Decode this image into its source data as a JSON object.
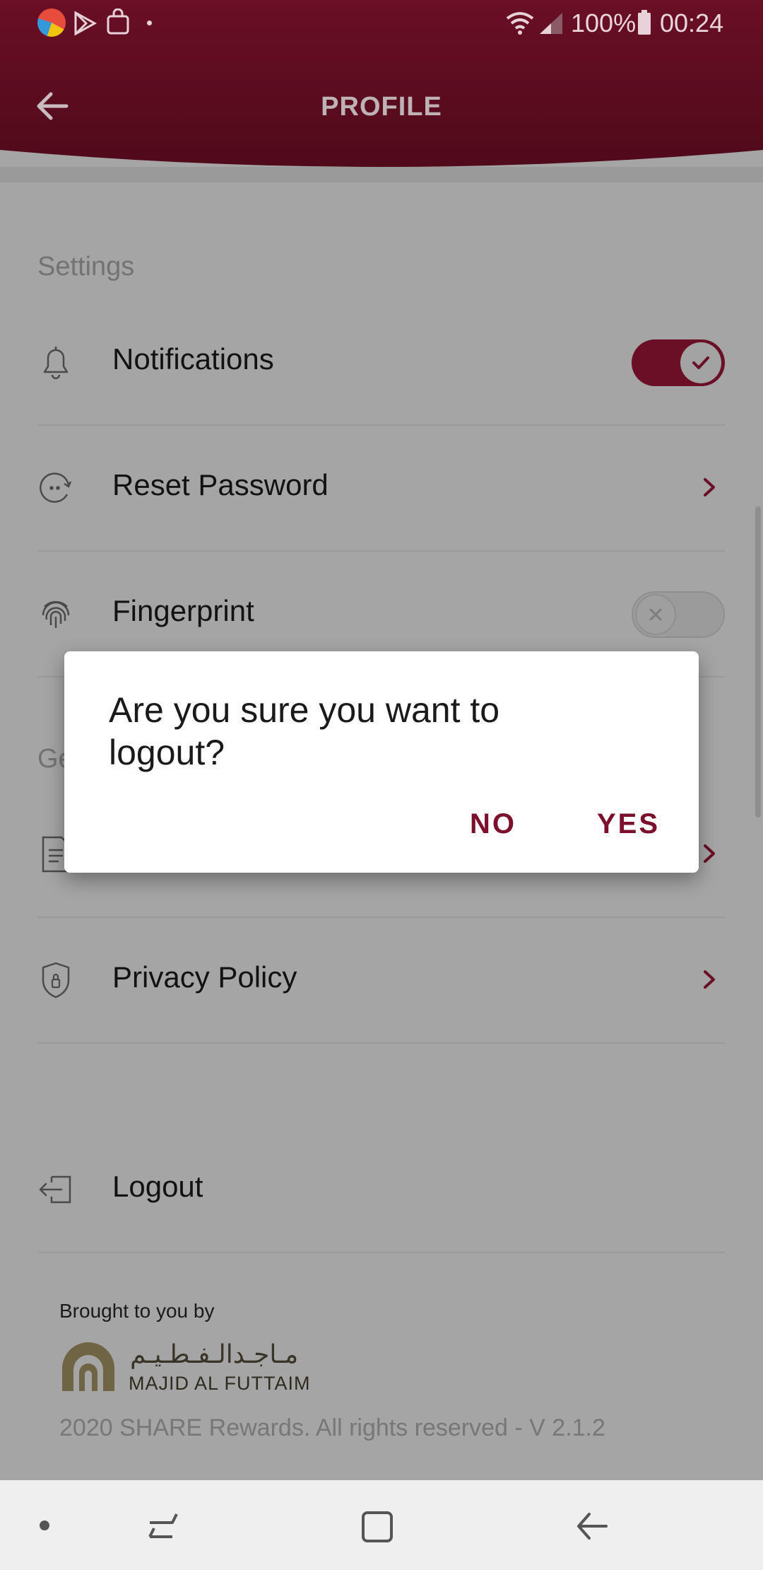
{
  "status_bar": {
    "battery": "100%",
    "time": "00:24",
    "left_icons": [
      "browser-icon",
      "play-store-icon",
      "shopping-bag-icon",
      "dot-icon"
    ],
    "right_icons": [
      "wifi-icon",
      "signal-icon",
      "battery-icon"
    ]
  },
  "header": {
    "title": "PROFILE"
  },
  "settings": {
    "section_title": "Settings",
    "items": [
      {
        "label": "Notifications",
        "icon": "bell-icon",
        "control": "toggle",
        "state": "on"
      },
      {
        "label": "Reset Password",
        "icon": "password-reset-icon",
        "control": "chevron"
      },
      {
        "label": "Fingerprint",
        "icon": "fingerprint-icon",
        "control": "toggle",
        "state": "off"
      }
    ]
  },
  "general": {
    "section_title_partial": "Ge",
    "items": [
      {
        "label": "",
        "icon": "document-icon",
        "control": "chevron"
      },
      {
        "label": "Privacy Policy",
        "icon": "shield-icon",
        "control": "chevron"
      }
    ]
  },
  "logout": {
    "label": "Logout",
    "icon": "logout-icon"
  },
  "footer": {
    "brought_by": "Brought to you by",
    "brand_en": "MAJID AL FUTTAIM",
    "brand_ar": "مـاجـدالـفـطـيـم",
    "copyright": "2020 SHARE Rewards. All rights reserved - V 2.1.2"
  },
  "dialog": {
    "message": "Are you sure you want to logout?",
    "no_label": "NO",
    "yes_label": "YES"
  },
  "colors": {
    "brand": "#6a0f25",
    "accent_button": "#7c0f2b",
    "scrim_background": "#a5a5a5"
  },
  "nav_bar": {
    "icons": [
      "dot-icon",
      "recent-apps-icon",
      "home-icon",
      "back-icon"
    ]
  }
}
